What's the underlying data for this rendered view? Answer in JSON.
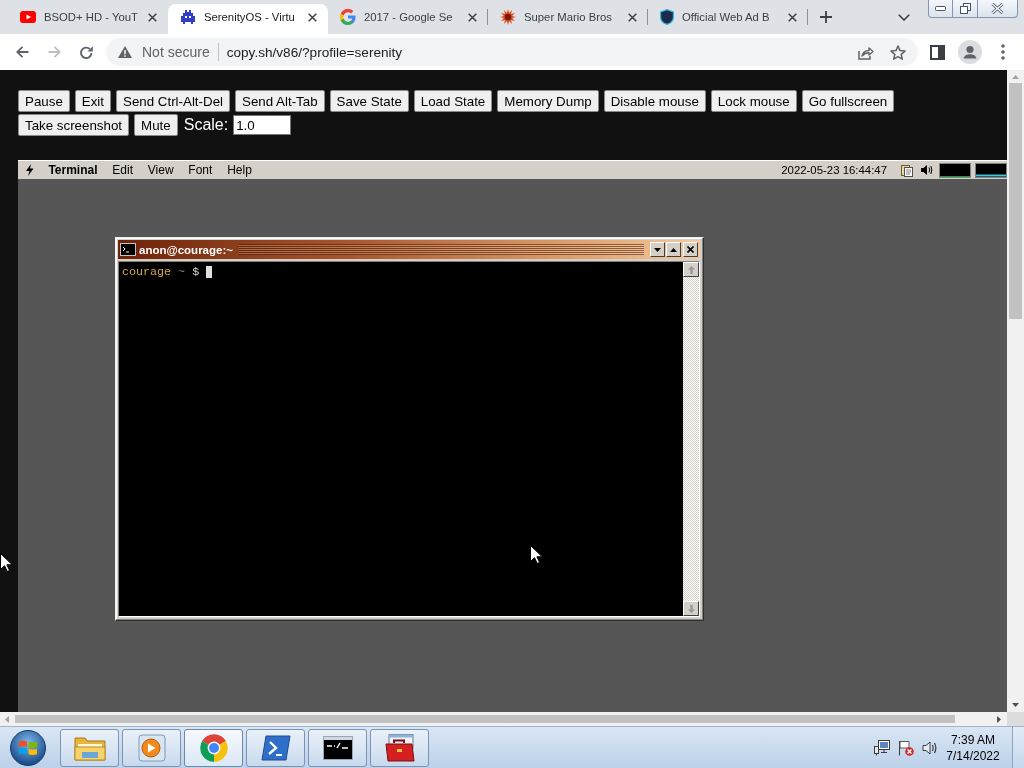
{
  "browser": {
    "tabs": [
      {
        "title": "BSOD+ HD - YouT",
        "selected": false
      },
      {
        "title": "SerenityOS - Virtu",
        "selected": true
      },
      {
        "title": "2017 - Google Se",
        "selected": false
      },
      {
        "title": "Super Mario Bros",
        "selected": false
      },
      {
        "title": "Official Web Ad B",
        "selected": false
      }
    ],
    "navigation": {
      "back_disabled": false,
      "forward_disabled": true
    },
    "security": "Not secure",
    "url": "copy.sh/v86/?profile=serenity"
  },
  "emulator": {
    "buttons": [
      "Pause",
      "Exit",
      "Send Ctrl-Alt-Del",
      "Send Alt-Tab",
      "Save State",
      "Load State",
      "Memory Dump",
      "Disable mouse",
      "Lock mouse",
      "Go fullscreen",
      "Take screenshot",
      "Mute"
    ],
    "scale_label": "Scale:",
    "scale_value": "1.0"
  },
  "vm": {
    "menus": [
      {
        "label": "Terminal",
        "kind": "app"
      },
      {
        "label": "Edit",
        "kind": "menu"
      },
      {
        "label": "View",
        "kind": "menu"
      },
      {
        "label": "Font",
        "kind": "menu"
      },
      {
        "label": "Help",
        "kind": "menu"
      }
    ],
    "clock": "2022-05-23 16:44:47",
    "terminal": {
      "title": "anon@courage:~",
      "prompt_host": "courage",
      "prompt_path": "~",
      "prompt_symbol": "$"
    }
  },
  "taskbar": {
    "apps": [
      {
        "selected": false
      },
      {
        "selected": false
      },
      {
        "selected": true
      },
      {
        "selected": false
      },
      {
        "selected": false
      },
      {
        "selected": false
      }
    ],
    "time": "7:39 AM",
    "date": "7/14/2022"
  }
}
